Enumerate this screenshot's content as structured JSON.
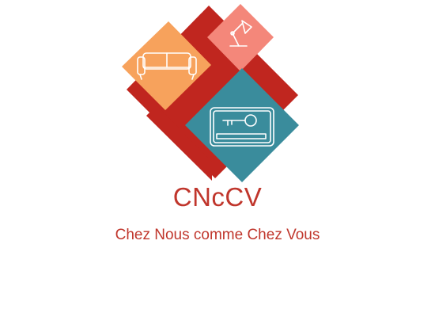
{
  "brand": {
    "name": "CNcCV",
    "tagline": "Chez Nous comme Chez Vous"
  },
  "icons": {
    "sofa": "sofa-icon",
    "lamp": "desk-lamp-icon",
    "key_card": "key-card-icon"
  },
  "colors": {
    "red": "#c0261f",
    "orange": "#f7a25c",
    "salmon": "#f4877a",
    "teal": "#3a8c9c",
    "text": "#c0362c",
    "line": "#ffffff"
  }
}
